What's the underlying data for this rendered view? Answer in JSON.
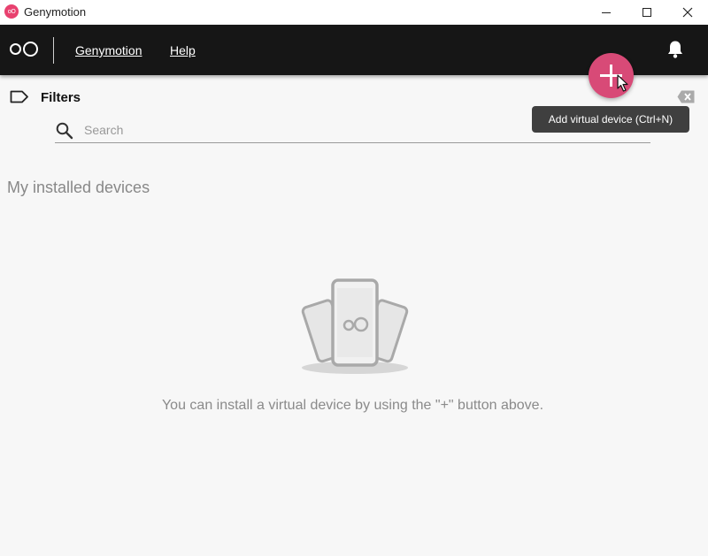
{
  "window": {
    "title": "Genymotion",
    "app_icon_text": "oO"
  },
  "topbar": {
    "menu_genymotion": "Genymotion",
    "menu_help": "Help"
  },
  "filters": {
    "label": "Filters"
  },
  "search": {
    "placeholder": "Search",
    "value": ""
  },
  "add_button": {
    "tooltip": "Add virtual device (Ctrl+N)"
  },
  "devices": {
    "section_title": "My installed devices",
    "empty_message": "You can install a virtual device by using the \"+\" button above."
  },
  "colors": {
    "accent": "#d84a77",
    "topbar": "#161616",
    "background": "#f7f7f7"
  }
}
